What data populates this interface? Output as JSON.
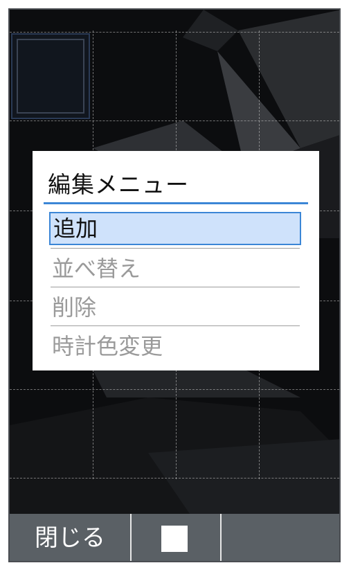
{
  "dialog": {
    "title": "編集メニュー",
    "items": [
      {
        "label": "追加",
        "selected": true,
        "enabled": true
      },
      {
        "label": "並べ替え",
        "selected": false,
        "enabled": false
      },
      {
        "label": "削除",
        "selected": false,
        "enabled": false
      },
      {
        "label": "時計色変更",
        "selected": false,
        "enabled": false
      }
    ]
  },
  "softkeys": {
    "left_label": "閉じる",
    "center_icon": "stop-square-icon",
    "right_label": ""
  },
  "colors": {
    "accent": "#3b86d6",
    "selection_bg": "#cfe2fb",
    "softbar_bg": "#5a6065",
    "disabled_text": "#9a9a9a"
  }
}
